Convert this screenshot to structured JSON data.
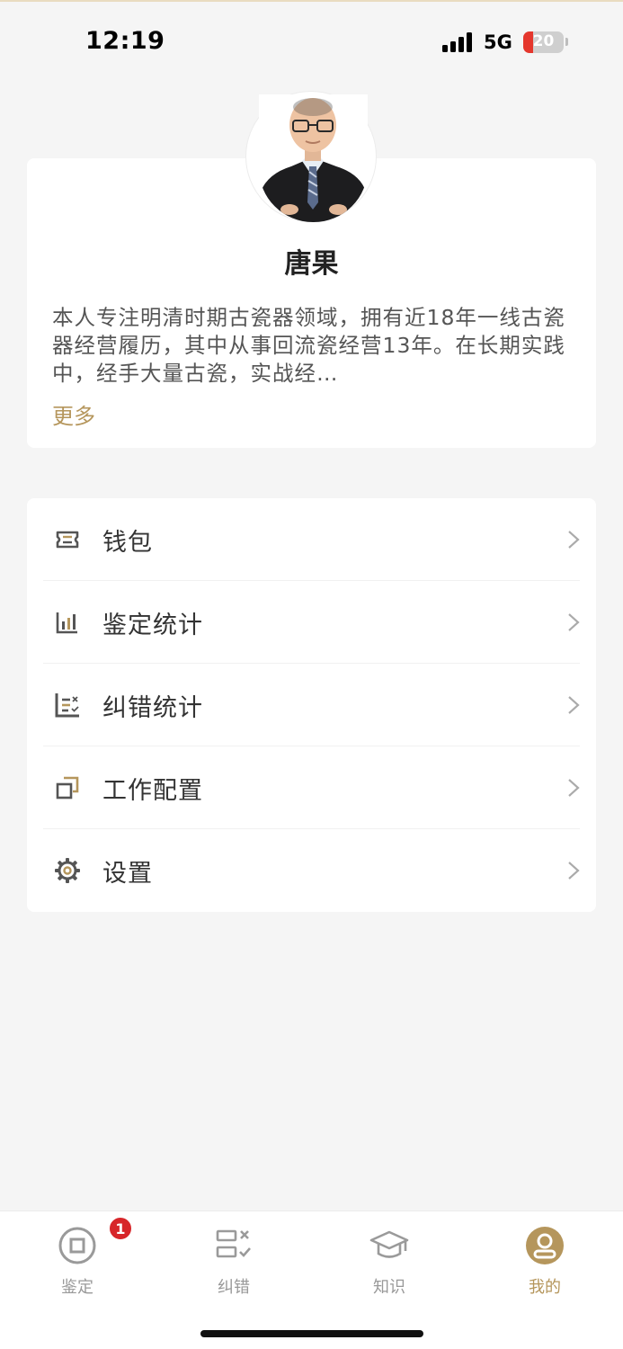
{
  "status_bar": {
    "time": "12:19",
    "network": "5G",
    "battery": "20"
  },
  "profile": {
    "name": "唐果",
    "bio": "本人专注明清时期古瓷器领域，拥有近18年一线古瓷器经营履历，其中从事回流瓷经营13年。在长期实践中，经手大量古瓷，实战经…",
    "more_label": "更多"
  },
  "menu": {
    "items": [
      {
        "label": "钱包",
        "icon": "wallet-icon"
      },
      {
        "label": "鉴定统计",
        "icon": "bar-chart-icon"
      },
      {
        "label": "纠错统计",
        "icon": "correction-stats-icon"
      },
      {
        "label": "工作配置",
        "icon": "overlap-squares-icon"
      },
      {
        "label": "设置",
        "icon": "gear-icon"
      }
    ]
  },
  "tabbar": {
    "tabs": [
      {
        "label": "鉴定",
        "icon": "coin-icon",
        "badge": "1",
        "active": false
      },
      {
        "label": "纠错",
        "icon": "list-check-icon",
        "active": false
      },
      {
        "label": "知识",
        "icon": "graduation-cap-icon",
        "active": false
      },
      {
        "label": "我的",
        "icon": "user-icon",
        "active": true
      }
    ]
  },
  "colors": {
    "accent": "#b5965c",
    "badge": "#d7262a",
    "background": "#f5f5f5",
    "icon": "#555555"
  }
}
